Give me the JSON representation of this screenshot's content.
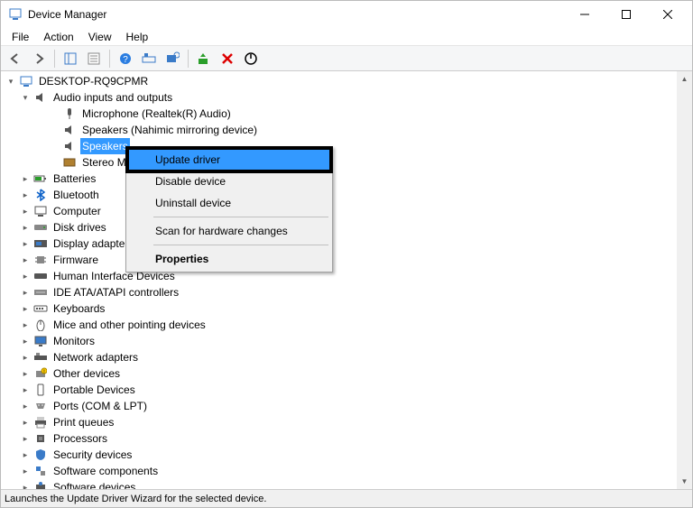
{
  "window": {
    "title": "Device Manager"
  },
  "menu": {
    "file": "File",
    "action": "Action",
    "view": "View",
    "help": "Help"
  },
  "tree": {
    "root": "DESKTOP-RQ9CPMR",
    "audio_group": "Audio inputs and outputs",
    "audio_children": {
      "mic": "Microphone (Realtek(R) Audio)",
      "speakers_mirror": "Speakers (Nahimic mirroring device)",
      "speakers": "Speakers",
      "stereo_mix": "Stereo Mi"
    },
    "groups": {
      "batteries": "Batteries",
      "bluetooth": "Bluetooth",
      "computer": "Computer",
      "disk": "Disk drives",
      "display": "Display adapte",
      "firmware": "Firmware",
      "hid": "Human Interface Devices",
      "ide": "IDE ATA/ATAPI controllers",
      "keyboards": "Keyboards",
      "mice": "Mice and other pointing devices",
      "monitors": "Monitors",
      "network": "Network adapters",
      "other": "Other devices",
      "portable": "Portable Devices",
      "ports": "Ports (COM & LPT)",
      "print": "Print queues",
      "processors": "Processors",
      "security": "Security devices",
      "software": "Software components",
      "software_dev": "Software devices"
    }
  },
  "context_menu": {
    "update": "Update driver",
    "disable": "Disable device",
    "uninstall": "Uninstall device",
    "scan": "Scan for hardware changes",
    "properties": "Properties"
  },
  "status": "Launches the Update Driver Wizard for the selected device."
}
